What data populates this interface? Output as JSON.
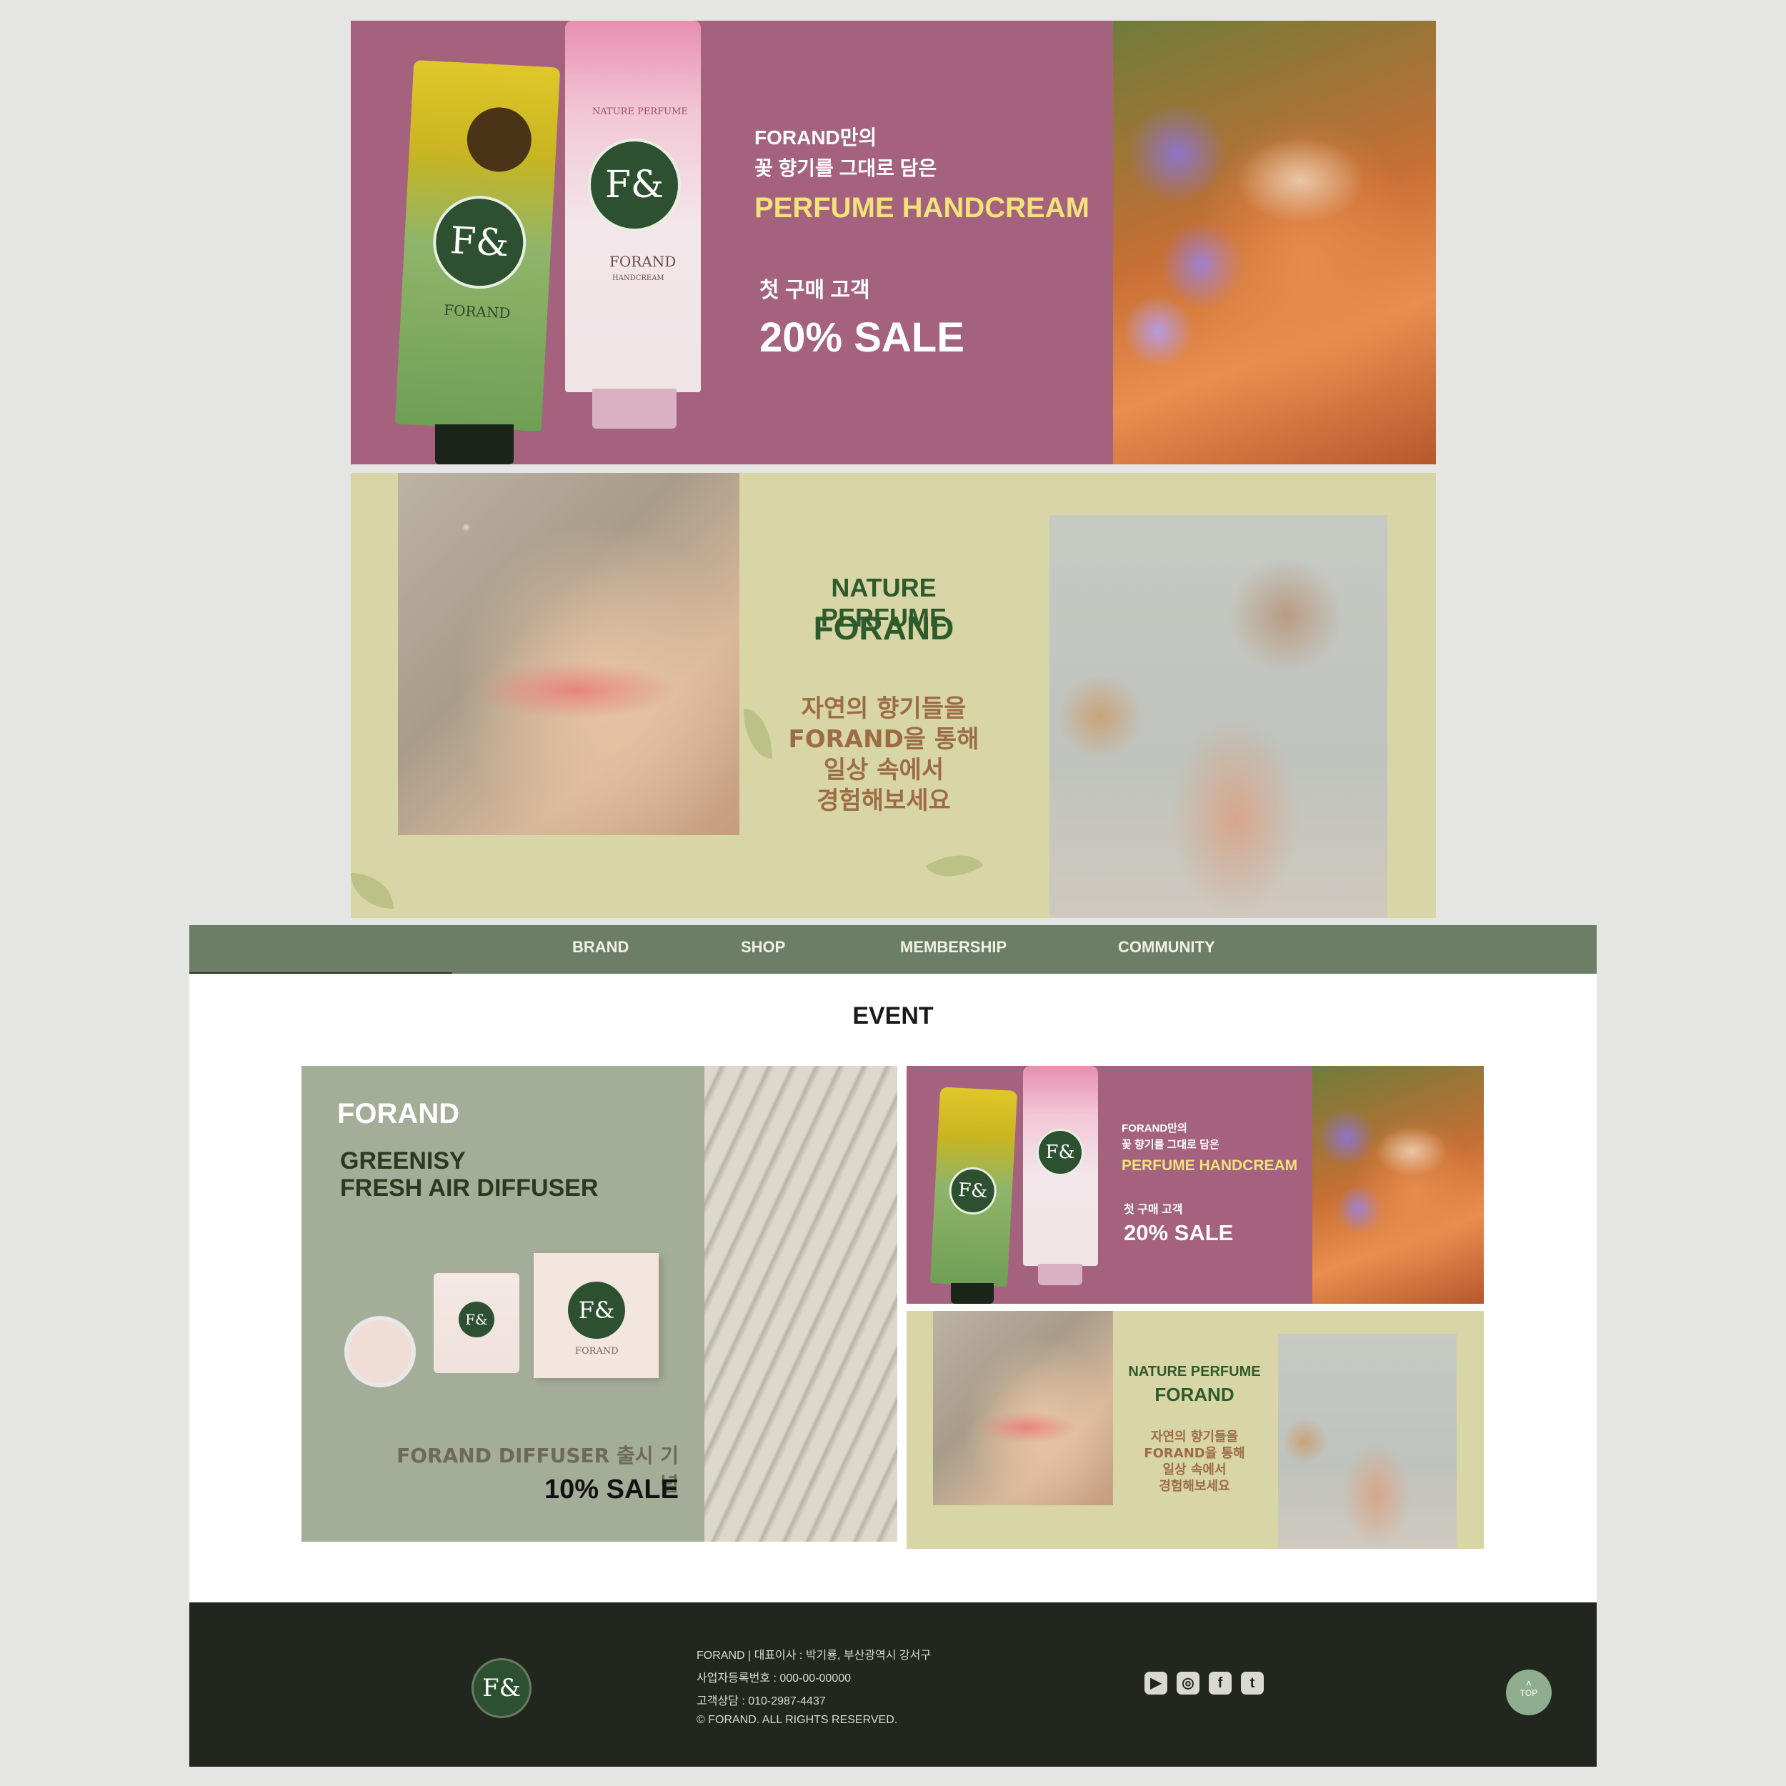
{
  "banner_hero_1": {
    "line1": "FORAND만의",
    "line2": "꽃 향기를 그대로 담은",
    "product": "PERFUME HANDCREAM",
    "promo_line": "첫 구매 고객",
    "promo_value": "20% SALE",
    "tube_brand": "FORAND",
    "tube_type": "HANDCREAM",
    "tube_tag": "NATURE PERFUME",
    "seal_text": "F&"
  },
  "banner_hero_2": {
    "tagline": "NATURE PERFUME",
    "brand": "FORAND",
    "copy_lines": [
      "자연의 향기들을",
      "FORAND을 통해",
      "일상 속에서",
      "경험해보세요"
    ]
  },
  "nav": {
    "items": [
      "BRAND",
      "SHOP",
      "MEMBERSHIP",
      "COMMUNITY"
    ]
  },
  "event": {
    "title": "EVENT",
    "diffuser": {
      "brand": "FORAND",
      "product_line1": "GREENISY",
      "product_line2": "FRESH AIR DIFFUSER",
      "launch": "FORAND DIFFUSER 출시 기념",
      "sale": "10% SALE",
      "box_brand": "FORAND",
      "seal_text": "F&"
    },
    "small_handcream": {
      "line1": "FORAND만의",
      "line2": "꽃 향기를 그대로 담은",
      "product": "PERFUME HANDCREAM",
      "promo_line": "첫 구매 고객",
      "promo_value": "20% SALE",
      "seal_text": "F&"
    },
    "small_nature": {
      "tagline": "NATURE PERFUME",
      "brand": "FORAND",
      "copy_lines": [
        "자연의 향기들을",
        "FORAND을 통해",
        "일상 속에서",
        "경험해보세요"
      ]
    }
  },
  "footer": {
    "logo_text": "F&",
    "info_lines": [
      "FORAND | 대표이사 : 박기룡, 부산광역시 강서구",
      "사업자등록번호 : 000-00-00000",
      "고객상담 : 010-2987-4437",
      "© FORAND. ALL RIGHTS RESERVED."
    ],
    "social_icons": [
      "youtube-icon",
      "instagram-icon",
      "facebook-icon",
      "twitter-icon"
    ],
    "top_button": {
      "arrow": "˄",
      "label": "TOP"
    }
  },
  "colors": {
    "page_bg": "#e5e5e3",
    "handcream_banner_bg": "#a4627f",
    "nature_banner_bg": "#d8d5a6",
    "nav_bg": "#6c7f66",
    "footer_bg": "#21261f",
    "accent_yellow": "#f2e27a",
    "forand_green": "#2f5a2b",
    "brown_copy": "#9c6d45",
    "top_button": "#8fae8f"
  }
}
